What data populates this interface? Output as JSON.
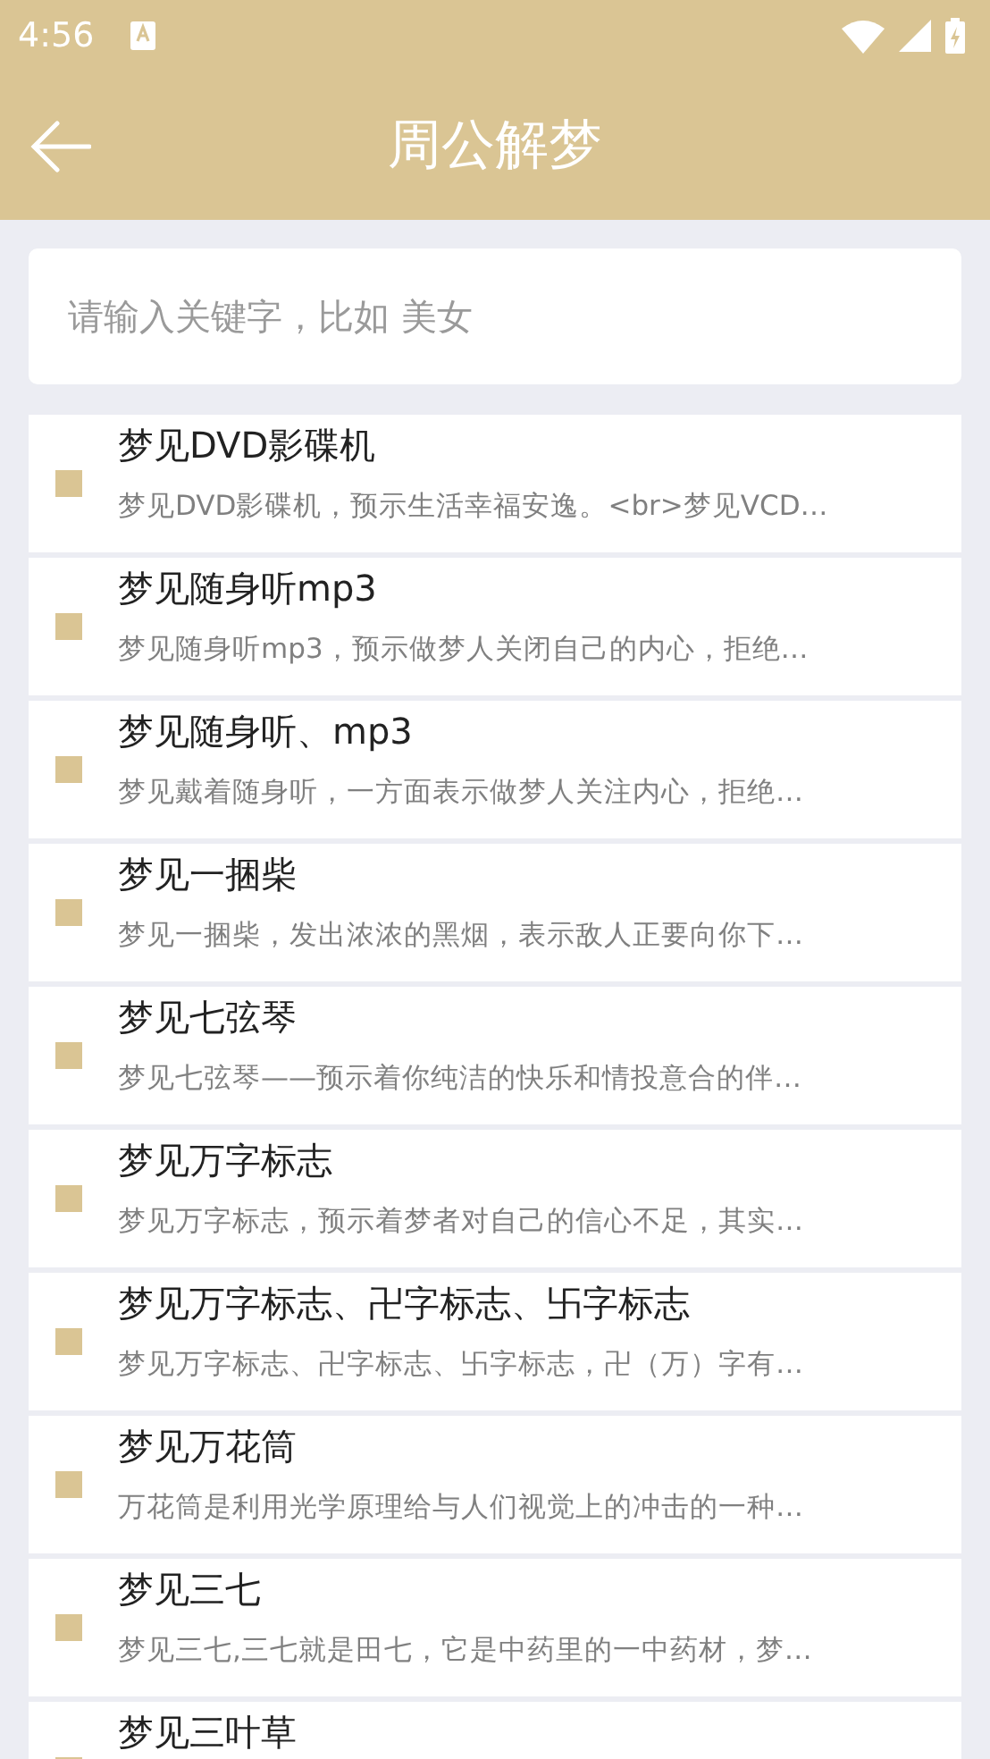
{
  "status_bar": {
    "time": "4:56"
  },
  "app_bar": {
    "title": "周公解梦"
  },
  "search": {
    "placeholder": "请输入关键字，比如 美女"
  },
  "items": [
    {
      "title": "梦见DVD影碟机",
      "summary": "梦见DVD影碟机，预示生活幸福安逸。<br>梦见VCD…"
    },
    {
      "title": "梦见随身听mp3",
      "summary": "梦见随身听mp3，预示做梦人关闭自己的内心，拒绝…"
    },
    {
      "title": "梦见随身听、mp3",
      "summary": "梦见戴着随身听，一方面表示做梦人关注内心，拒绝…"
    },
    {
      "title": "梦见一捆柴",
      "summary": "梦见一捆柴，发出浓浓的黑烟，表示敌人正要向你下…"
    },
    {
      "title": "梦见七弦琴",
      "summary": "梦见七弦琴——预示着你纯洁的快乐和情投意合的伴…"
    },
    {
      "title": "梦见万字标志",
      "summary": "梦见万字标志，预示着梦者对自己的信心不足，其实…"
    },
    {
      "title": "梦见万字标志、卍字标志、卐字标志",
      "summary": "梦见万字标志、卍字标志、卐字标志，卍（万）字有…"
    },
    {
      "title": "梦见万花筒",
      "summary": "万花筒是利用光学原理给与人们视觉上的冲击的一种…"
    },
    {
      "title": "梦见三七",
      "summary": "梦见三七,三七就是田七，它是中药里的一中药材，梦…"
    },
    {
      "title": "梦见三叶草"
    }
  ]
}
